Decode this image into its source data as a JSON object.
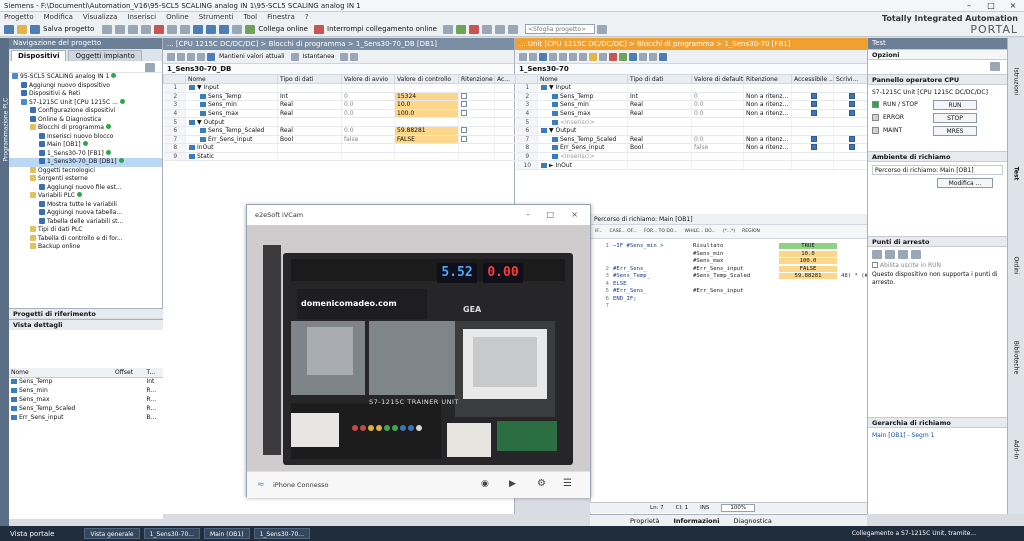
{
  "window_title": "Siemens - F:\\Documenti\\Automation_V16\\95-SCL5 SCALING analog IN 1\\95-SCL5 SCALING analog IN 1",
  "menu": [
    "Progetto",
    "Modifica",
    "Visualizza",
    "Inserisci",
    "Online",
    "Strumenti",
    "Tool",
    "Finestra",
    "?"
  ],
  "toolbar": {
    "save_label": "Salva progetto",
    "online_label": "Collega online",
    "offline_label": "Interrompi collegamento online",
    "search_placeholder": "<Sfoglia progetto>"
  },
  "brand": {
    "line1": "Totally Integrated Automation",
    "line2": "PORTAL"
  },
  "side_tab": "Programmazione PLC",
  "nav": {
    "title": "Navigazione del progetto",
    "tabs": [
      "Dispositivi",
      "Oggetti impianto"
    ],
    "tree": [
      {
        "label": "95-SCL5 SCALING analog IN 1",
        "indent": 0,
        "icon": "c",
        "ok": true
      },
      {
        "label": "Aggiungi nuovo dispositivo",
        "indent": 1,
        "icon": "b"
      },
      {
        "label": "Dispositivi & Reti",
        "indent": 1,
        "icon": "b"
      },
      {
        "label": "S7-1215C Unit [CPU 1215C ...",
        "indent": 1,
        "icon": "c",
        "ok": true
      },
      {
        "label": "Configurazione dispositivi",
        "indent": 2,
        "icon": "b"
      },
      {
        "label": "Online & Diagnostica",
        "indent": 2,
        "icon": "b"
      },
      {
        "label": "Blocchi di programma",
        "indent": 2,
        "icon": "f",
        "ok": true
      },
      {
        "label": "Inserisci nuovo blocco",
        "indent": 3,
        "icon": "b"
      },
      {
        "label": "Main [OB1]",
        "indent": 3,
        "icon": "b",
        "ok": true
      },
      {
        "label": "1_Sens30-70 [FB1]",
        "indent": 3,
        "icon": "b",
        "ok": true
      },
      {
        "label": "1_Sens30-70_DB [DB1]",
        "indent": 3,
        "icon": "b",
        "ok": true,
        "selected": true
      },
      {
        "label": "Oggetti tecnologici",
        "indent": 2,
        "icon": "f"
      },
      {
        "label": "Sorgenti esterne",
        "indent": 2,
        "icon": "f"
      },
      {
        "label": "Aggiungi nuovo file est...",
        "indent": 3,
        "icon": "b"
      },
      {
        "label": "Variabili PLC",
        "indent": 2,
        "icon": "f",
        "ok": true
      },
      {
        "label": "Mostra tutte le variabili",
        "indent": 3,
        "icon": "b"
      },
      {
        "label": "Aggiungi nuova tabella...",
        "indent": 3,
        "icon": "b"
      },
      {
        "label": "Tabella delle variabili st...",
        "indent": 3,
        "icon": "b"
      },
      {
        "label": "Tipi di dati PLC",
        "indent": 2,
        "icon": "f"
      },
      {
        "label": "Tabella di controllo e di for...",
        "indent": 2,
        "icon": "f"
      },
      {
        "label": "Backup online",
        "indent": 2,
        "icon": "f"
      }
    ],
    "ref_projects": "Progetti di riferimento",
    "details": {
      "title": "Vista dettagli",
      "headers": [
        "Nome",
        "Offset",
        "T..."
      ],
      "rows": [
        [
          "Sens_Temp",
          "",
          "Int"
        ],
        [
          "Sens_min",
          "",
          "R..."
        ],
        [
          "Sens_max",
          "",
          "R..."
        ],
        [
          "Sens_Temp_Scaled",
          "",
          "R..."
        ],
        [
          "Err_Sens_input",
          "",
          "B..."
        ]
      ]
    }
  },
  "db_editor": {
    "path": "... [CPU 1215C DC/DC/DC] > Blocchi di programma > 1_Sens30-70_DB [DB1]",
    "toolbar_keep": "Mantieni valori attuali",
    "toolbar_snapshot": "Istantanea",
    "block_name": "1_Sens30-70_DB",
    "headers": [
      "",
      "Nome",
      "Tipo di dati",
      "Valore di avvio",
      "Valore di controllo",
      "Ritenzione",
      "Ac..."
    ],
    "rows": [
      {
        "n": "1",
        "name": "▼ Input",
        "type": "",
        "start": "",
        "mon": "",
        "sec": true
      },
      {
        "n": "2",
        "name": "Sens_Temp",
        "type": "Int",
        "start": "0",
        "mon": "15324",
        "sub": true
      },
      {
        "n": "3",
        "name": "Sens_min",
        "type": "Real",
        "start": "0.0",
        "mon": "10.0",
        "sub": true
      },
      {
        "n": "4",
        "name": "Sens_max",
        "type": "Real",
        "start": "0.0",
        "mon": "100.0",
        "sub": true
      },
      {
        "n": "5",
        "name": "▼ Output",
        "type": "",
        "start": "",
        "mon": "",
        "sec": true
      },
      {
        "n": "6",
        "name": "Sens_Temp_Scaled",
        "type": "Real",
        "start": "0.0",
        "mon": "59.88281",
        "sub": true
      },
      {
        "n": "7",
        "name": "Err_Sens_input",
        "type": "Bool",
        "start": "false",
        "mon": "FALSE",
        "sub": true
      },
      {
        "n": "8",
        "name": "InOut",
        "type": "",
        "start": "",
        "mon": "",
        "sec": true
      },
      {
        "n": "9",
        "name": "Static",
        "type": "",
        "start": "",
        "mon": "",
        "sec": true
      }
    ]
  },
  "fb_editor": {
    "path": "... Unit [CPU 1215C DC/DC/DC] > Blocchi di programma > 1_Sens30-70 [FB1]",
    "block_name": "1_Sens30-70",
    "headers": [
      "",
      "Nome",
      "Tipo di dati",
      "Valore di default",
      "Ritenzione",
      "Accessibile ...",
      "Scrivi..."
    ],
    "rows": [
      {
        "n": "1",
        "name": "▼ Input",
        "type": "",
        "def": "",
        "ret": "",
        "sec": true
      },
      {
        "n": "2",
        "name": "Sens_Temp",
        "type": "Int",
        "def": "0",
        "ret": "Non a ritenz...",
        "sub": true
      },
      {
        "n": "3",
        "name": "Sens_min",
        "type": "Real",
        "def": "0.0",
        "ret": "Non a ritenz...",
        "sub": true
      },
      {
        "n": "4",
        "name": "Sens_max",
        "type": "Real",
        "def": "0.0",
        "ret": "Non a ritenz...",
        "sub": true
      },
      {
        "n": "5",
        "name": "<Inserisci>",
        "type": "",
        "def": "",
        "ret": "",
        "sub": true,
        "ins": true
      },
      {
        "n": "6",
        "name": "▼ Output",
        "type": "",
        "def": "",
        "ret": "",
        "sec": true
      },
      {
        "n": "7",
        "name": "Sens_Temp_Scaled",
        "type": "Real",
        "def": "0.0",
        "ret": "Non a ritenz...",
        "sub": true
      },
      {
        "n": "8",
        "name": "Err_Sens_input",
        "type": "Bool",
        "def": "false",
        "ret": "Non a ritenz...",
        "sub": true
      },
      {
        "n": "9",
        "name": "<Inserisci>",
        "type": "",
        "def": "",
        "ret": "",
        "sub": true,
        "ins": true
      },
      {
        "n": "10",
        "name": "► InOut",
        "type": "",
        "def": "",
        "ret": "",
        "sec": true
      }
    ]
  },
  "code": {
    "call_path": "Percorso di richiamo: Main [OB1]",
    "toolbar": [
      "IF...",
      "CASE... OF...",
      "FOR... TO DO...",
      "WHILE... DO...",
      "(*...*)",
      "REGION"
    ],
    "lines": [
      {
        "n": "1",
        "text": "−IF #Sens_min >"
      },
      {
        "n": "",
        "text": ""
      },
      {
        "n": "",
        "text": ""
      },
      {
        "n": "2",
        "text": "     #Err_Sens_"
      },
      {
        "n": "3",
        "text": "     #Sens_Temp_"
      },
      {
        "n": "4",
        "text": " ELSE"
      },
      {
        "n": "5",
        "text": "     #Err_Sens_"
      },
      {
        "n": "6",
        "text": " END_IF;"
      },
      {
        "n": "7",
        "text": ""
      }
    ],
    "monitor": [
      {
        "name": "Risultato",
        "val": "TRUE",
        "t": true
      },
      {
        "name": "#Sens_min",
        "val": "10.0"
      },
      {
        "name": "#Sens_max",
        "val": "100.0"
      },
      {
        "name": "#Err_Sens_input",
        "val": "FALSE"
      },
      {
        "name": "#Sens_Temp_Scaled",
        "val": "59.88281"
      },
      {
        "name": "",
        "val": ""
      },
      {
        "name": "#Err_Sens_input",
        "val": ""
      }
    ],
    "trail": "48) * (#Sen",
    "status": {
      "ln": "Ln: 7",
      "cl": "Cl: 1",
      "ins": "INS",
      "zoom": "100%"
    }
  },
  "inspector_tabs": [
    "Proprietà",
    "Informazioni",
    "Diagnostica"
  ],
  "task": {
    "title": "Test",
    "options": "Opzioni",
    "cpu_panel": "Pannello operatore CPU",
    "cpu_name": "S7-1215C Unit [CPU 1215C DC/DC/DC]",
    "leds": [
      {
        "label": "RUN / STOP",
        "btn": "RUN",
        "color": "#2aa94a"
      },
      {
        "label": "ERROR",
        "btn": "STOP",
        "color": "#d0d0d0"
      },
      {
        "label": "MAINT",
        "btn": "MRES",
        "color": "#d0d0d0"
      }
    ],
    "call_env": "Ambiente di richiamo",
    "call_path": "Percorso di richiamo: Main [OB1]",
    "modify": "Modifica ...",
    "breakpoints": "Punti di arresto",
    "enable_exit": "Abilita uscite in RUN",
    "bp_note": "Questo dispositivo non supporta i punti di arresto.",
    "call_hier": "Gerarchia di richiamo",
    "call_hier_item": "Main [OB1] - Segm 1"
  },
  "right_tabs": [
    "Istruzioni",
    "Test",
    "Ordini",
    "Biblioteche",
    "Add-In"
  ],
  "camera": {
    "title": "e2eSoft iVCam",
    "status": "iPhone Connesso",
    "display_left": "5.52",
    "display_right": "0.00",
    "site": "domenicomadeo.com",
    "unit": "S7-1215C TRAINER UNIT",
    "brand_logo": "GEA"
  },
  "status_bar": {
    "portal": "Vista portale",
    "tabs": [
      "Vista generale",
      "1_Sens30-70...",
      "Main (OB1)",
      "1_Sens30-70..."
    ],
    "connection": "Collegamento a S7-1215C Unit, tramite..."
  }
}
